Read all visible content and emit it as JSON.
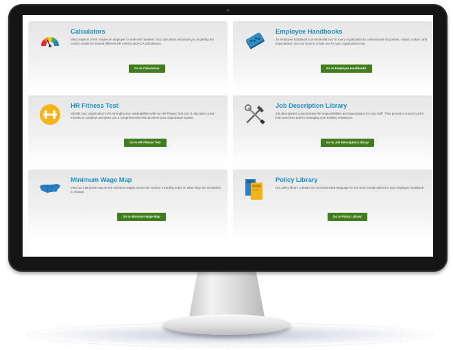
{
  "tools": [
    {
      "title": "Calculators",
      "description": "Many aspects of HR require an employer to work with numbers. Our calculators will assist you in getting the correct results for several different HR metrics and ACA calculations.",
      "button": "Go to Calculators",
      "icon": "speedometer-icon"
    },
    {
      "title": "Employee Handbooks",
      "description": "An employee handbook is an essential tool for every organization to communicate its policies, values, culture, and expectations. Use our tools to create one for your organization now.",
      "button": "Go to Employee Handbooks",
      "icon": "handbook-icon"
    },
    {
      "title": "HR Fitness Test",
      "description": "Identify your organization's HR strengths and vulnerabilities with our HR Fitness Test tool. It only takes a few minutes to complete and gives you a comprehensive look at where your organization stands.",
      "button": "Go to HR Fitness Test",
      "icon": "dumbbell-icon"
    },
    {
      "title": "Job Description Library",
      "description": "Job descriptions communicate the responsibilities and expectations for your staff. They provide a crucial tool for both new hires and for managing your existing employees.",
      "button": "Go to Job Description Library",
      "icon": "tools-icon"
    },
    {
      "title": "Minimum Wage Map",
      "description": "View our interactive map to see minimum wages across the country, including notes on when they are scheduled to change.",
      "button": "Go to Minimum Wage Map",
      "icon": "us-map-icon"
    },
    {
      "title": "Policy Library",
      "description": "Our policy library contains our recommended language for the most crucial policies in your employee handbook.",
      "button": "Go to Policy Library",
      "icon": "books-icon"
    }
  ],
  "colors": {
    "title": "#1b8fc6",
    "button_bg": "#3f7d1d",
    "card_bg": "#ececec",
    "bezel": "#151515"
  }
}
